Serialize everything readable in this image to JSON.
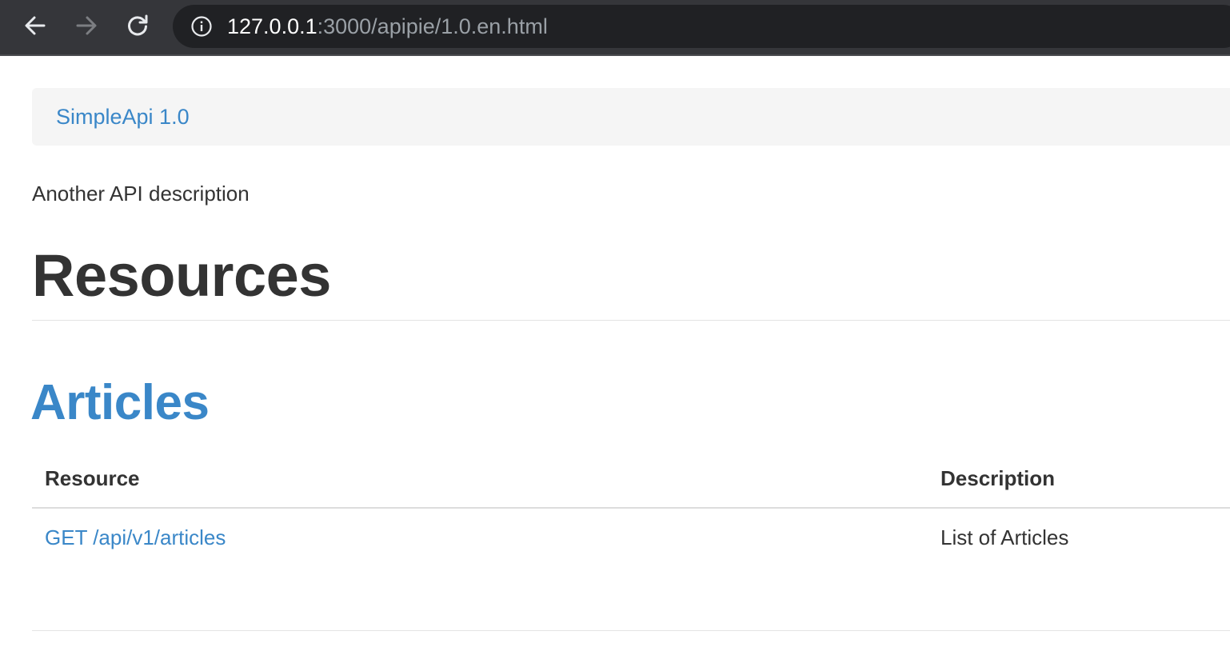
{
  "browser": {
    "url_host": "127.0.0.1",
    "url_rest": ":3000/apipie/1.0.en.html",
    "icons": {
      "back": "arrow-left-icon",
      "forward": "arrow-right-icon",
      "reload": "reload-icon",
      "site_info": "info-circle-icon"
    },
    "colors": {
      "toolbar": "#35363a",
      "omnibox": "#202124",
      "url_host": "#ffffff",
      "url_path": "#9aa0a6"
    }
  },
  "navbar": {
    "brand": "SimpleApi 1.0"
  },
  "page": {
    "description": "Another API description",
    "title": "Resources"
  },
  "sections": [
    {
      "title": "Articles",
      "table": {
        "headers": [
          "Resource",
          "Description"
        ],
        "rows": [
          {
            "resource": "GET /api/v1/articles",
            "description": "List of Articles"
          }
        ]
      }
    }
  ],
  "colors": {
    "link": "#3a87c8",
    "text": "#333333",
    "navbar_bg": "#f5f5f5"
  }
}
